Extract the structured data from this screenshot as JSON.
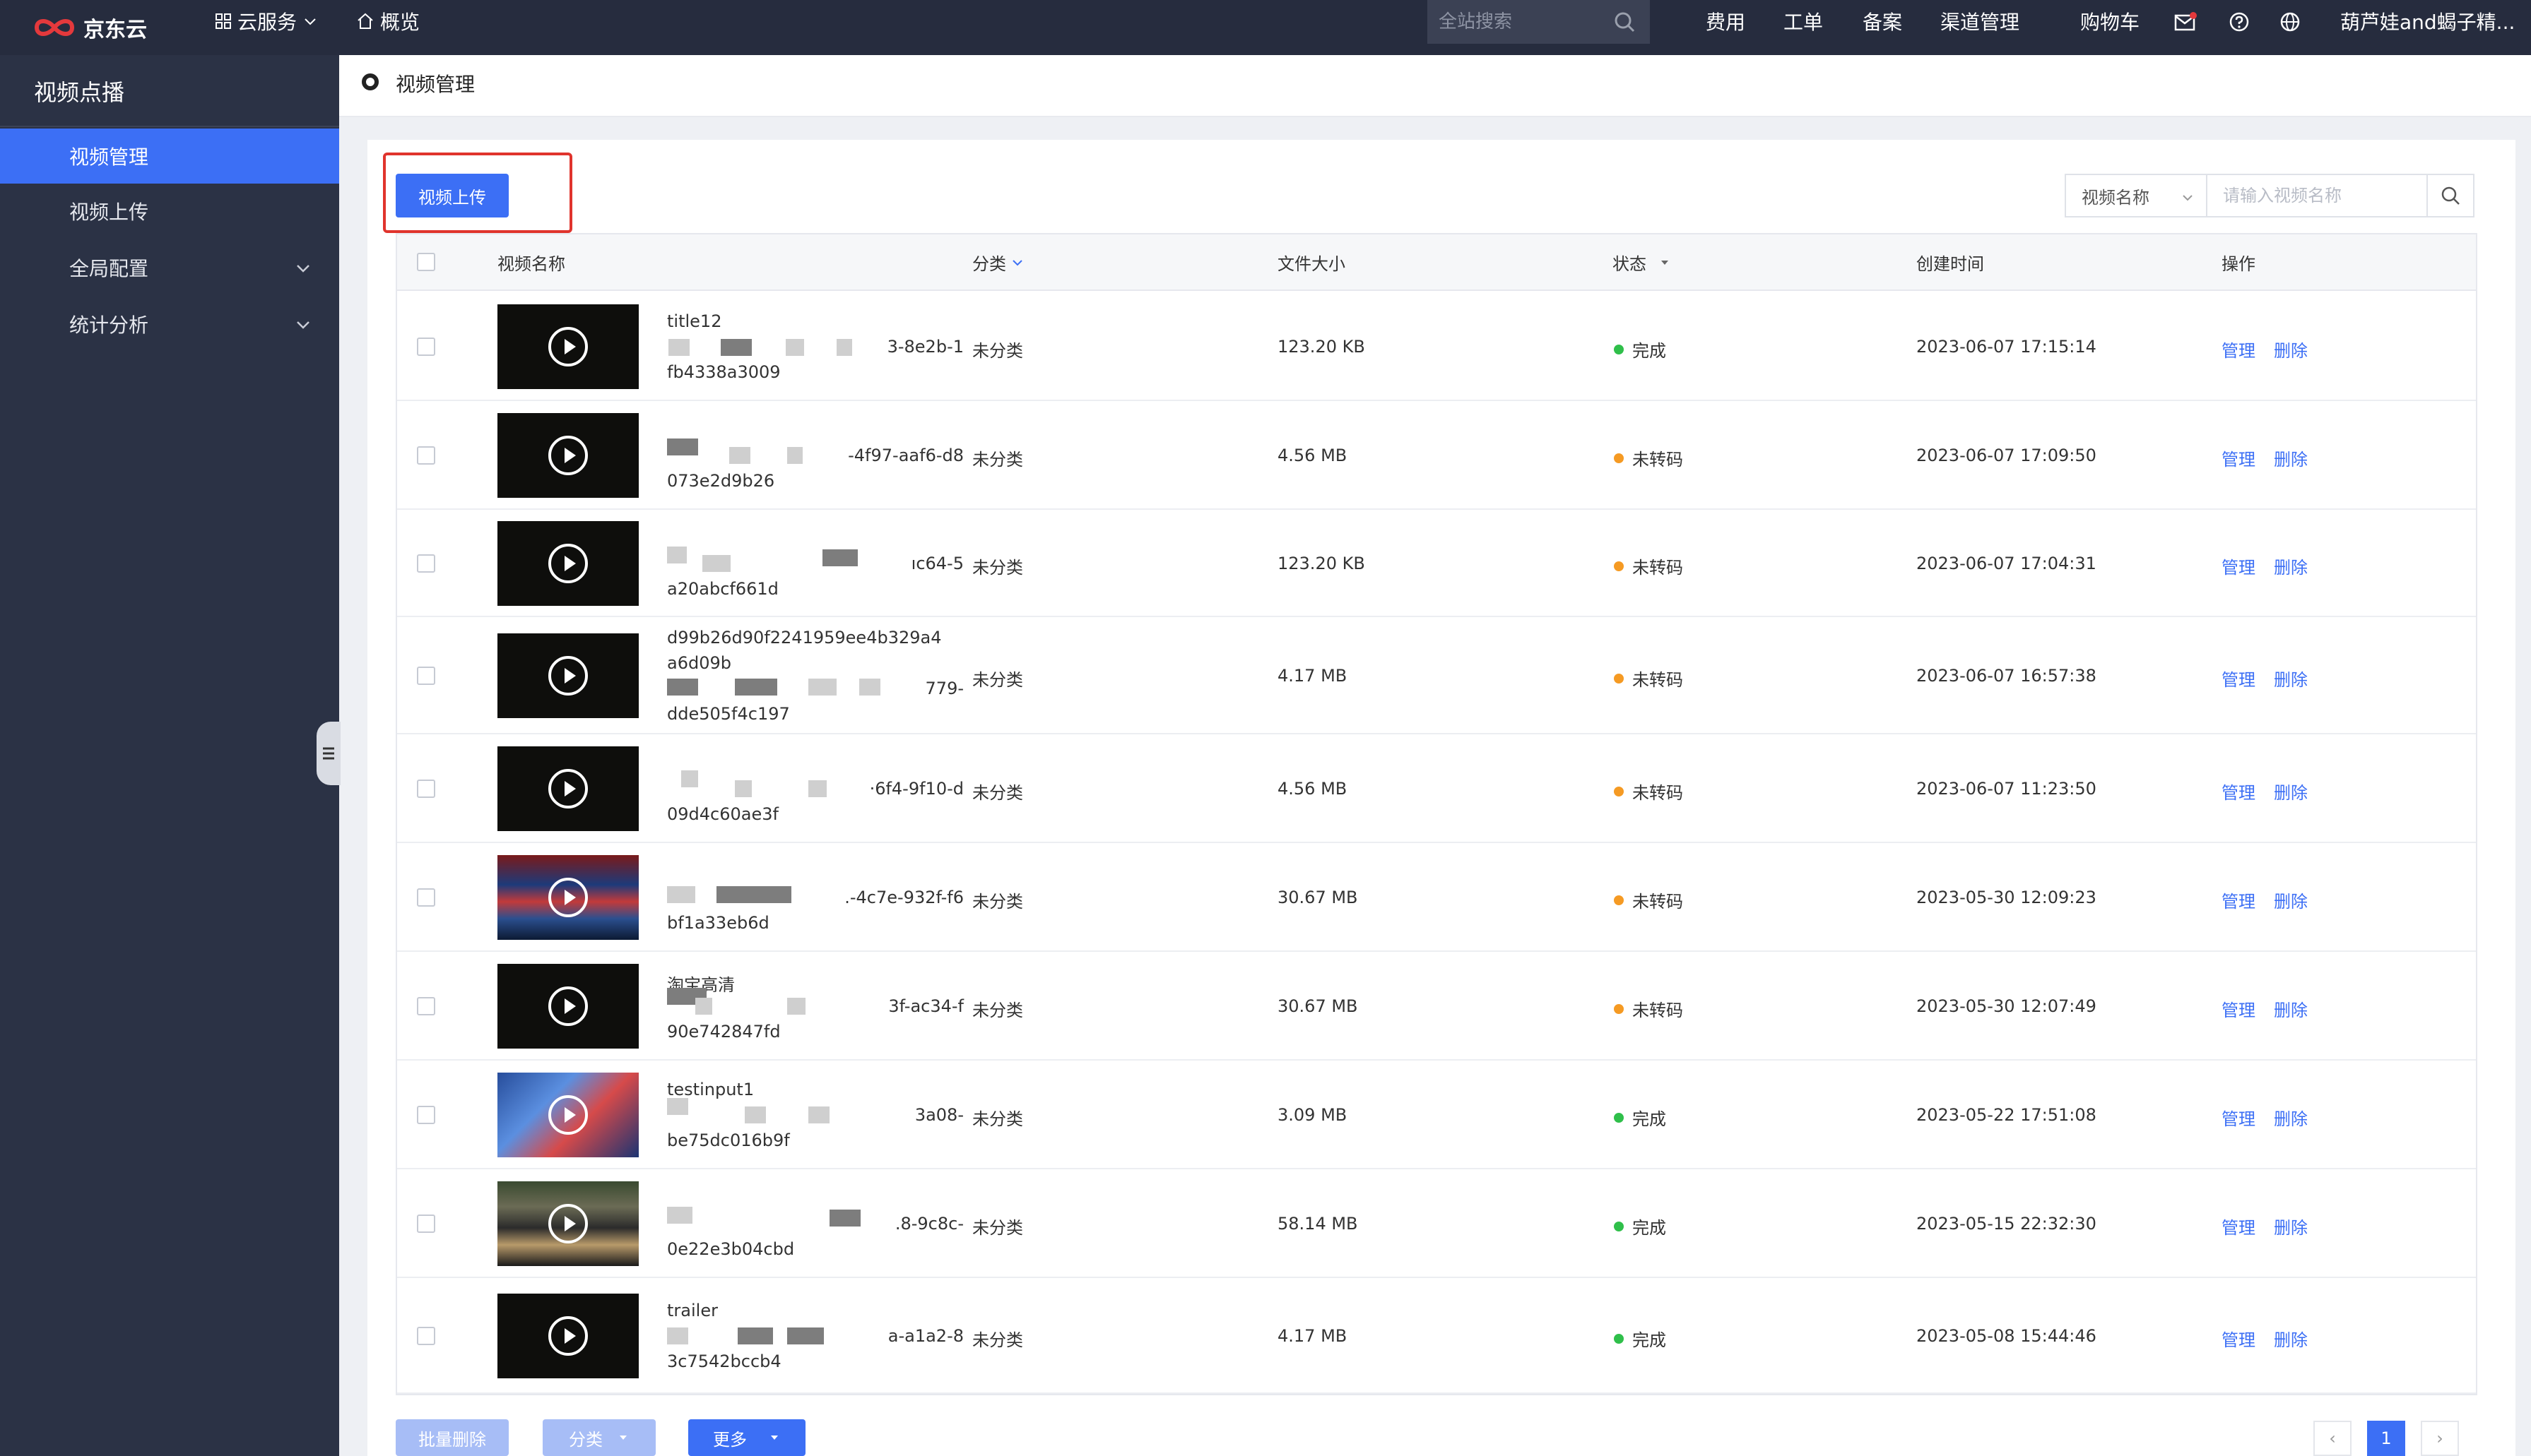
{
  "topbar": {
    "brand": "京东云",
    "cloud_services": "云服务",
    "overview": "概览",
    "search_placeholder": "全站搜索",
    "links": [
      "费用",
      "工单",
      "备案",
      "渠道管理",
      "购物车"
    ],
    "user": "葫芦娃and蝎子精..."
  },
  "sidebar": {
    "title": "视频点播",
    "items": [
      {
        "label": "视频管理"
      },
      {
        "label": "视频上传"
      },
      {
        "label": "全局配置"
      },
      {
        "label": "统计分析"
      }
    ]
  },
  "header": {
    "title": "视频管理"
  },
  "toolbar": {
    "upload_label": "视频上传",
    "filter_select": "视频名称",
    "filter_placeholder": "请输入视频名称"
  },
  "table": {
    "columns": {
      "name": "视频名称",
      "category": "分类",
      "size": "文件大小",
      "status": "状态",
      "created": "创建时间",
      "ops": "操作"
    },
    "manage_label": "管理",
    "delete_label": "删除",
    "rows": [
      {
        "line1": "title12",
        "line2": "3-8e2b-1",
        "line3": "fb4338a3009",
        "category": "未分类",
        "size": "123.20 KB",
        "status": "完成",
        "created": "2023-06-07 17:15:14"
      },
      {
        "line1": "",
        "line2": "-4f97-aaf6-d8",
        "line3": "073e2d9b26",
        "category": "未分类",
        "size": "4.56 MB",
        "status": "未转码",
        "created": "2023-06-07 17:09:50"
      },
      {
        "line1": "",
        "line2": "ıc64-5",
        "line3": "a20abcf661d",
        "category": "未分类",
        "size": "123.20 KB",
        "status": "未转码",
        "created": "2023-06-07 17:04:31"
      },
      {
        "line1": "d99b26d90f2241959ee4b329a4",
        "line2": "a6d09b",
        "line3": "779-",
        "line4": "dde505f4c197",
        "category": "未分类",
        "size": "4.17 MB",
        "status": "未转码",
        "created": "2023-06-07 16:57:38"
      },
      {
        "line1": "",
        "line2": "·6f4-9f10-d",
        "line3": "09d4c60ae3f",
        "category": "未分类",
        "size": "4.56 MB",
        "status": "未转码",
        "created": "2023-06-07 11:23:50"
      },
      {
        "line1": "",
        "line2": ".-4c7e-932f-f6",
        "line3": "bf1a33eb6d",
        "category": "未分类",
        "size": "30.67 MB",
        "status": "未转码",
        "created": "2023-05-30 12:09:23"
      },
      {
        "line1": "淘宝高清",
        "line2": "3f-ac34-f",
        "line3": "90e742847fd",
        "category": "未分类",
        "size": "30.67 MB",
        "status": "未转码",
        "created": "2023-05-30 12:07:49"
      },
      {
        "line1": "testinput1",
        "line2": "3a08-",
        "line3": "be75dc016b9f",
        "category": "未分类",
        "size": "3.09 MB",
        "status": "完成",
        "created": "2023-05-22 17:51:08"
      },
      {
        "line1": "",
        "line2": ".8-9c8c-",
        "line3": "0e22e3b04cbd",
        "category": "未分类",
        "size": "58.14 MB",
        "status": "完成",
        "created": "2023-05-15 22:32:30"
      },
      {
        "line1": "trailer",
        "line2": "a-a1a2-8",
        "line3": "3c7542bccb4",
        "category": "未分类",
        "size": "4.17 MB",
        "status": "完成",
        "created": "2023-05-08 15:44:46"
      }
    ]
  },
  "footer": {
    "batch_delete": "批量删除",
    "category": "分类",
    "more": "更多",
    "prev": "‹",
    "page": "1",
    "next": "›"
  },
  "colors": {
    "accent": "#3c6ff5",
    "status_done": "#2fbf4a",
    "status_pending": "#f59a23",
    "highlight": "#e0342d"
  }
}
